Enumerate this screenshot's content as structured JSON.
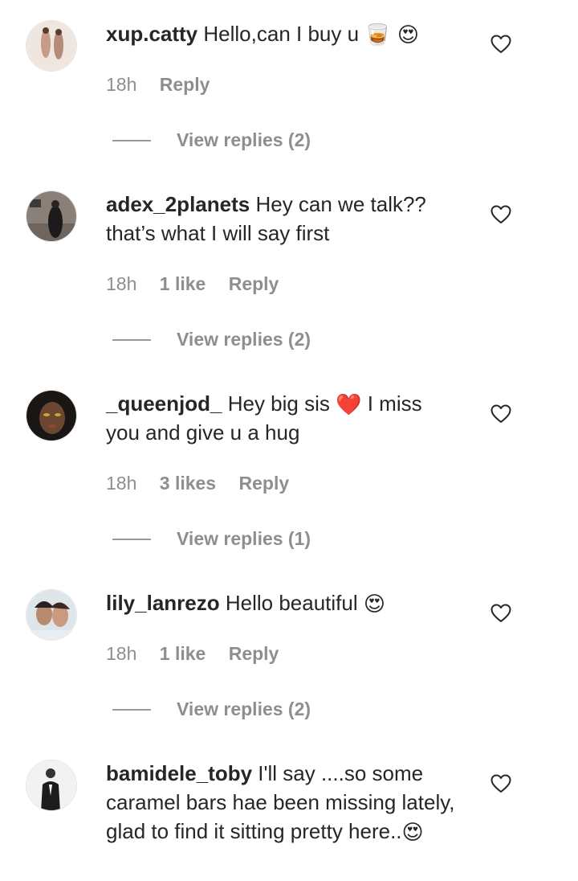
{
  "comments": [
    {
      "username": "xup.catty",
      "text": "Hello,can I buy u",
      "emoji": "🥃 😍",
      "time": "18h",
      "likes": "",
      "reply_label": "Reply",
      "view_replies": "View replies (2)"
    },
    {
      "username": "adex_2planets",
      "text": "Hey can we talk?? that’s what I will say first",
      "emoji": "",
      "time": "18h",
      "likes": "1 like",
      "reply_label": "Reply",
      "view_replies": "View replies (2)"
    },
    {
      "username": "_queenjod_",
      "text_before": "Hey big sis",
      "emoji": "❤️",
      "text_after": "I miss you and give u a hug",
      "time": "18h",
      "likes": "3 likes",
      "reply_label": "Reply",
      "view_replies": "View replies (1)"
    },
    {
      "username": "lily_lanrezo",
      "text": "Hello beautiful",
      "emoji": "😍",
      "time": "18h",
      "likes": "1 like",
      "reply_label": "Reply",
      "view_replies": "View replies (2)"
    },
    {
      "username": "bamidele_toby",
      "text": "I'll say ....so some caramel bars hae been missing lately, glad to find it sitting pretty here..",
      "emoji": "😍"
    }
  ],
  "icons": {
    "heart": "heart-outline-icon"
  },
  "colors": {
    "text": "#262626",
    "meta": "#8e8e8e",
    "heart_stroke": "#262626"
  }
}
